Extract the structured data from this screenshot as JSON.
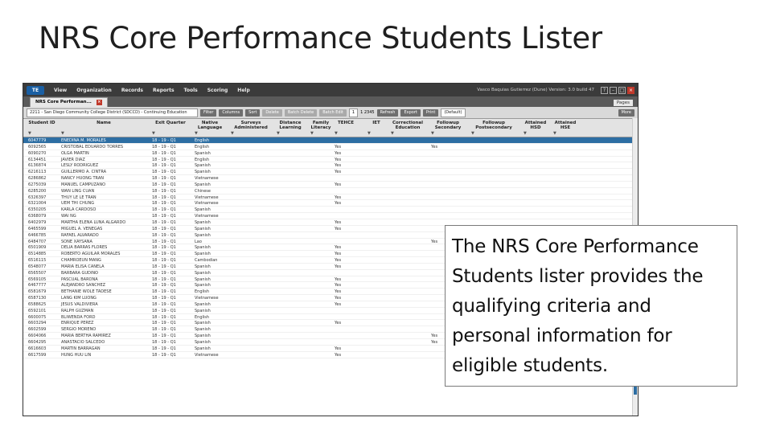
{
  "slide": {
    "title": "NRS Core Performance Students Lister",
    "callout_text": "The NRS Core Performance Students lister provides the qualifying criteria and personal information for eligible students."
  },
  "app": {
    "logo": "TE",
    "menu": [
      "View",
      "Organization",
      "Records",
      "Reports",
      "Tools",
      "Scoring",
      "Help"
    ],
    "user_info": "Vasco Baquias Gutierrez (Dune)    Version: 3.0 build 47",
    "tab_label": "NRS Core Performan...",
    "tab_right": "Pages",
    "toolbar": {
      "agency": "2211 - San Diego Community College District (SDCCD) - Continuing Education",
      "buttons": [
        "Filter",
        "Columns",
        "Sort",
        "Delete",
        "Batch Delete",
        "Batch Edit"
      ],
      "pager": "1",
      "total": "1 2345",
      "refresh": "Refresh",
      "export": "Export",
      "print": "Print",
      "view": "(Default)",
      "more": "More"
    },
    "columns": [
      "Student ID",
      "Name",
      "Exit Quarter",
      "Native Language",
      "Surveys Administered",
      "Distance Learning",
      "Family Literacy",
      "TEHCE",
      "IET",
      "Correctional Education",
      "Followup Secondary",
      "Followup Postsecondary",
      "Attained HSD",
      "Attained HSE"
    ],
    "rows": [
      [
        "6047779",
        "ENEDINA M. MORALES",
        "18 - 19 - Q1",
        "English",
        "",
        "",
        "",
        "",
        "",
        "",
        "",
        "",
        "",
        ""
      ],
      [
        "6092565",
        "CRISTOBAL EDUARDO TORRES",
        "18 - 19 - Q1",
        "English",
        "",
        "",
        "",
        "Yes",
        "",
        "",
        "Yes",
        "",
        "",
        ""
      ],
      [
        "6090270",
        "OLGA MARTIN",
        "18 - 19 - Q1",
        "Spanish",
        "",
        "",
        "",
        "Yes",
        "",
        "",
        "",
        "",
        "",
        ""
      ],
      [
        "6134451",
        "JAVIER DIAZ",
        "18 - 19 - Q1",
        "English",
        "",
        "",
        "",
        "Yes",
        "",
        "",
        "",
        "",
        "",
        ""
      ],
      [
        "6136874",
        "LESLY RODRIGUEZ",
        "18 - 19 - Q1",
        "Spanish",
        "",
        "",
        "",
        "Yes",
        "",
        "",
        "",
        "",
        "",
        ""
      ],
      [
        "6216113",
        "GUILLERMO A. CINTRA",
        "18 - 19 - Q1",
        "Spanish",
        "",
        "",
        "",
        "Yes",
        "",
        "",
        "",
        "",
        "",
        ""
      ],
      [
        "6286862",
        "NANCY HUONG TRAN",
        "18 - 19 - Q1",
        "Vietnamese",
        "",
        "",
        "",
        "",
        "",
        "",
        "",
        "",
        "",
        ""
      ],
      [
        "6275039",
        "MANUEL CAMPUZANO",
        "18 - 19 - Q1",
        "Spanish",
        "",
        "",
        "",
        "Yes",
        "",
        "",
        "",
        "",
        "",
        ""
      ],
      [
        "6285200",
        "WAN LING CUAN",
        "18 - 19 - Q1",
        "Chinese",
        "",
        "",
        "",
        "",
        "",
        "",
        "",
        "",
        "",
        ""
      ],
      [
        "6326397",
        "THUY LE LE TRAN",
        "18 - 19 - Q1",
        "Vietnamese",
        "",
        "",
        "",
        "Yes",
        "",
        "",
        "",
        "",
        "",
        ""
      ],
      [
        "6321004",
        "UEM THI CHUNG",
        "18 - 19 - Q1",
        "Vietnamese",
        "",
        "",
        "",
        "Yes",
        "",
        "",
        "",
        "",
        "",
        ""
      ],
      [
        "6350205",
        "KARLA CARDOSO",
        "18 - 19 - Q1",
        "Spanish",
        "",
        "",
        "",
        "",
        "",
        "",
        "",
        "",
        "",
        ""
      ],
      [
        "6368079",
        "WAI NG",
        "18 - 19 - Q1",
        "Vietnamese",
        "",
        "",
        "",
        "",
        "",
        "",
        "",
        "",
        "",
        ""
      ],
      [
        "6402979",
        "MARTHA ELENA LUNA ALGARDO",
        "18 - 19 - Q1",
        "Spanish",
        "",
        "",
        "",
        "Yes",
        "",
        "",
        "",
        "",
        "",
        ""
      ],
      [
        "6465599",
        "MIGUEL A. VENEGAS",
        "18 - 19 - Q1",
        "Spanish",
        "",
        "",
        "",
        "Yes",
        "",
        "",
        "",
        "",
        "",
        ""
      ],
      [
        "6466785",
        "RAFAEL ALVARADO",
        "18 - 19 - Q1",
        "Spanish",
        "",
        "",
        "",
        "",
        "",
        "",
        "",
        "",
        "",
        ""
      ],
      [
        "6484707",
        "SONE XAYSANA",
        "18 - 19 - Q1",
        "Lao",
        "",
        "",
        "",
        "",
        "",
        "",
        "Yes",
        "",
        "",
        ""
      ],
      [
        "6501909",
        "DELIA BARRAS FLORES",
        "18 - 19 - Q1",
        "Spanish",
        "",
        "",
        "",
        "Yes",
        "",
        "",
        "",
        "",
        "",
        ""
      ],
      [
        "6514885",
        "ROBERTO AGUILAR MORALES",
        "18 - 19 - Q1",
        "Spanish",
        "",
        "",
        "",
        "Yes",
        "",
        "",
        "",
        "",
        "",
        ""
      ],
      [
        "6516115",
        "CHAMROEUN MANG",
        "18 - 19 - Q1",
        "Cambodian",
        "",
        "",
        "",
        "Yes",
        "",
        "",
        "",
        "",
        "",
        ""
      ],
      [
        "6548077",
        "MARIA ELISA CANELA",
        "18 - 19 - Q1",
        "Spanish",
        "",
        "",
        "",
        "Yes",
        "",
        "",
        "",
        "",
        "",
        ""
      ],
      [
        "6565507",
        "BARBARA GUDINO",
        "18 - 19 - Q1",
        "Spanish",
        "",
        "",
        "",
        "",
        "",
        "",
        "",
        "",
        "",
        ""
      ],
      [
        "6569105",
        "PASCUAL BARONA",
        "18 - 19 - Q1",
        "Spanish",
        "",
        "",
        "",
        "Yes",
        "",
        "",
        "",
        "",
        "",
        ""
      ],
      [
        "6467777",
        "ALEJANDRO SANCHEZ",
        "18 - 19 - Q1",
        "Spanish",
        "",
        "",
        "",
        "Yes",
        "",
        "",
        "",
        "",
        "",
        ""
      ],
      [
        "6581679",
        "BETHANIE WOLE TADESE",
        "18 - 19 - Q1",
        "English",
        "",
        "",
        "",
        "Yes",
        "",
        "",
        "",
        "",
        "",
        ""
      ],
      [
        "6587130",
        "LANG KIM LUONG",
        "18 - 19 - Q1",
        "Vietnamese",
        "",
        "",
        "",
        "Yes",
        "",
        "",
        "",
        "",
        "",
        ""
      ],
      [
        "6588625",
        "JESUS VALDIVIERA",
        "18 - 19 - Q1",
        "Spanish",
        "",
        "",
        "",
        "Yes",
        "",
        "",
        "",
        "",
        "",
        ""
      ],
      [
        "6592101",
        "RALPH GUZMAN",
        "18 - 19 - Q1",
        "Spanish",
        "",
        "",
        "",
        "",
        "",
        "",
        "",
        "",
        "",
        ""
      ],
      [
        "6600075",
        "BLIWENDA FORD",
        "18 - 19 - Q1",
        "English",
        "",
        "",
        "",
        "",
        "",
        "",
        "",
        "",
        "",
        ""
      ],
      [
        "6603294",
        "ENRIQUE PEREZ",
        "18 - 19 - Q1",
        "Spanish",
        "",
        "",
        "",
        "Yes",
        "",
        "",
        "",
        "",
        "",
        ""
      ],
      [
        "6602599",
        "SERGIO MORENO",
        "18 - 19 - Q1",
        "Spanish",
        "",
        "",
        "",
        "",
        "",
        "",
        "",
        "",
        "",
        ""
      ],
      [
        "6604066",
        "MARIA BERTHA RAMIREZ",
        "18 - 19 - Q1",
        "Spanish",
        "",
        "",
        "",
        "",
        "",
        "",
        "Yes",
        "",
        "",
        ""
      ],
      [
        "6604295",
        "ANASTACIO SALCEDO",
        "18 - 19 - Q1",
        "Spanish",
        "",
        "",
        "",
        "",
        "",
        "",
        "Yes",
        "",
        "",
        ""
      ],
      [
        "6616603",
        "MARTIN BARRAGAN",
        "18 - 19 - Q1",
        "Spanish",
        "",
        "",
        "",
        "Yes",
        "",
        "",
        "",
        "",
        "",
        ""
      ],
      [
        "6617599",
        "HUNG HUU LIN",
        "18 - 19 - Q1",
        "Vietnamese",
        "",
        "",
        "",
        "Yes",
        "",
        "",
        "",
        "",
        "",
        ""
      ]
    ]
  }
}
